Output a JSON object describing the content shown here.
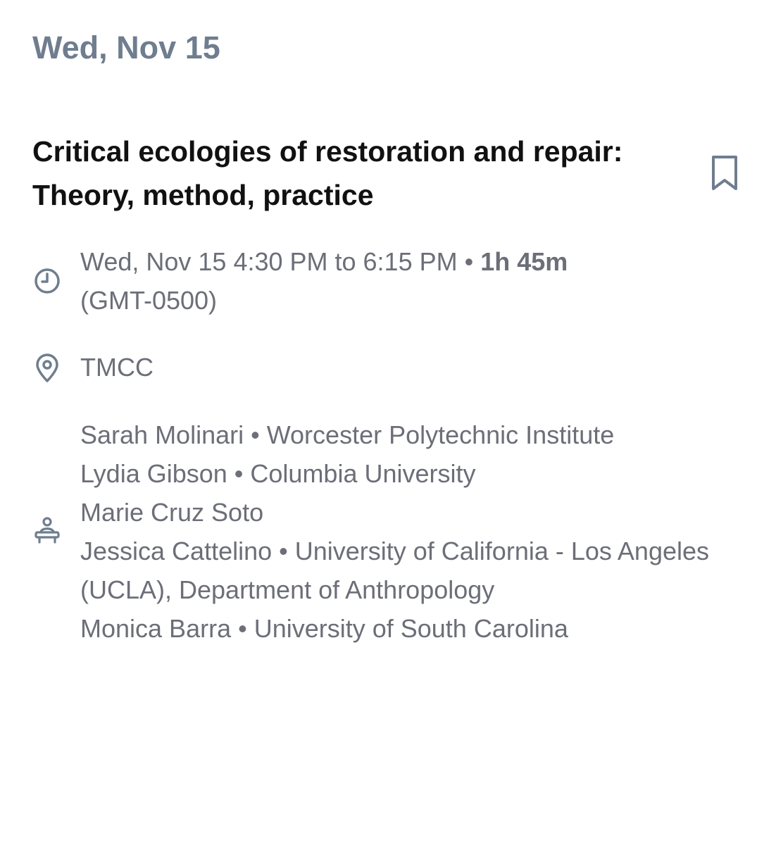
{
  "date_header": "Wed, Nov 15",
  "session": {
    "title": "Critical ecologies of restoration and repair: Theory, method, practice",
    "time_range": "Wed, Nov 15 4:30 PM to 6:15 PM",
    "separator": " • ",
    "duration": "1h 45m",
    "timezone": "(GMT-0500)",
    "location": "TMCC",
    "people": [
      "Sarah Molinari • Worcester Polytechnic Institute",
      "Lydia Gibson • Columbia University",
      "Marie Cruz Soto",
      "Jessica Cattelino • University of California - Los Angeles (UCLA), Department of Anthropology",
      "Monica Barra • University of South Carolina"
    ]
  },
  "icons": {
    "bookmark": "bookmark-icon",
    "time": "clock-icon",
    "location": "map-pin-icon",
    "people": "presenter-icon"
  },
  "colors": {
    "date_header": "#6f7d8f",
    "title": "#111111",
    "meta_text": "#6c6e78",
    "icon": "#6f7d8f"
  }
}
